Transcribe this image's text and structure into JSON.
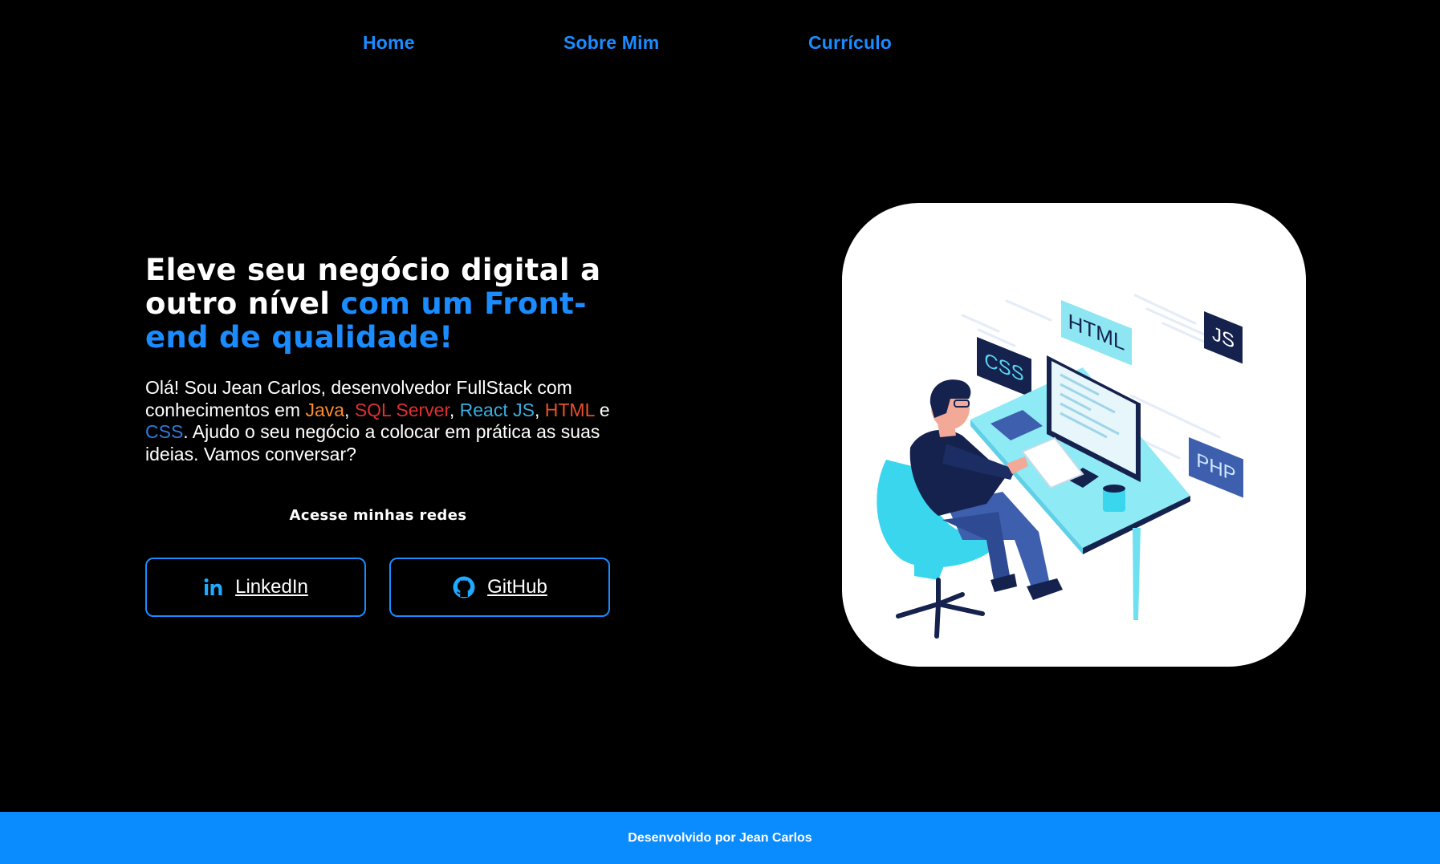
{
  "nav": {
    "items": [
      {
        "label": "Home"
      },
      {
        "label": "Sobre Mim"
      },
      {
        "label": "Currículo"
      }
    ]
  },
  "hero": {
    "title_part1": "Eleve seu negócio digital a outro nível ",
    "title_accent": "com um Front-end de qualidade!",
    "desc": {
      "intro": "Olá! Sou Jean Carlos, desenvolvedor FullStack com conhecimentos em ",
      "java": "Java",
      "sep1": ", ",
      "sql": "SQL Server",
      "sep2": ", ",
      "react": "React JS",
      "sep3": ", ",
      "html": "HTML",
      "sep4": " e ",
      "css": "CSS",
      "outro": ". Ajudo o seu negócio a colocar em prática as suas ideias. Vamos conversar?"
    },
    "social_title": "Acesse minhas redes",
    "buttons": {
      "linkedin": "LinkedIn",
      "github": "GitHub"
    }
  },
  "illustration": {
    "tags": {
      "html": "HTML",
      "css": "CSS",
      "js": "JS",
      "php": "PHP"
    }
  },
  "footer": {
    "text": "Desenvolvido por Jean Carlos"
  },
  "colors": {
    "accent": "#1a8cff",
    "footer_bg": "#0a8cff",
    "java": "#ff8c2a",
    "sql": "#e0302f",
    "react": "#3aaee0",
    "html": "#e8502a",
    "css": "#2d7be0"
  },
  "icons": {
    "linkedin": "linkedin-icon",
    "github": "github-icon"
  }
}
